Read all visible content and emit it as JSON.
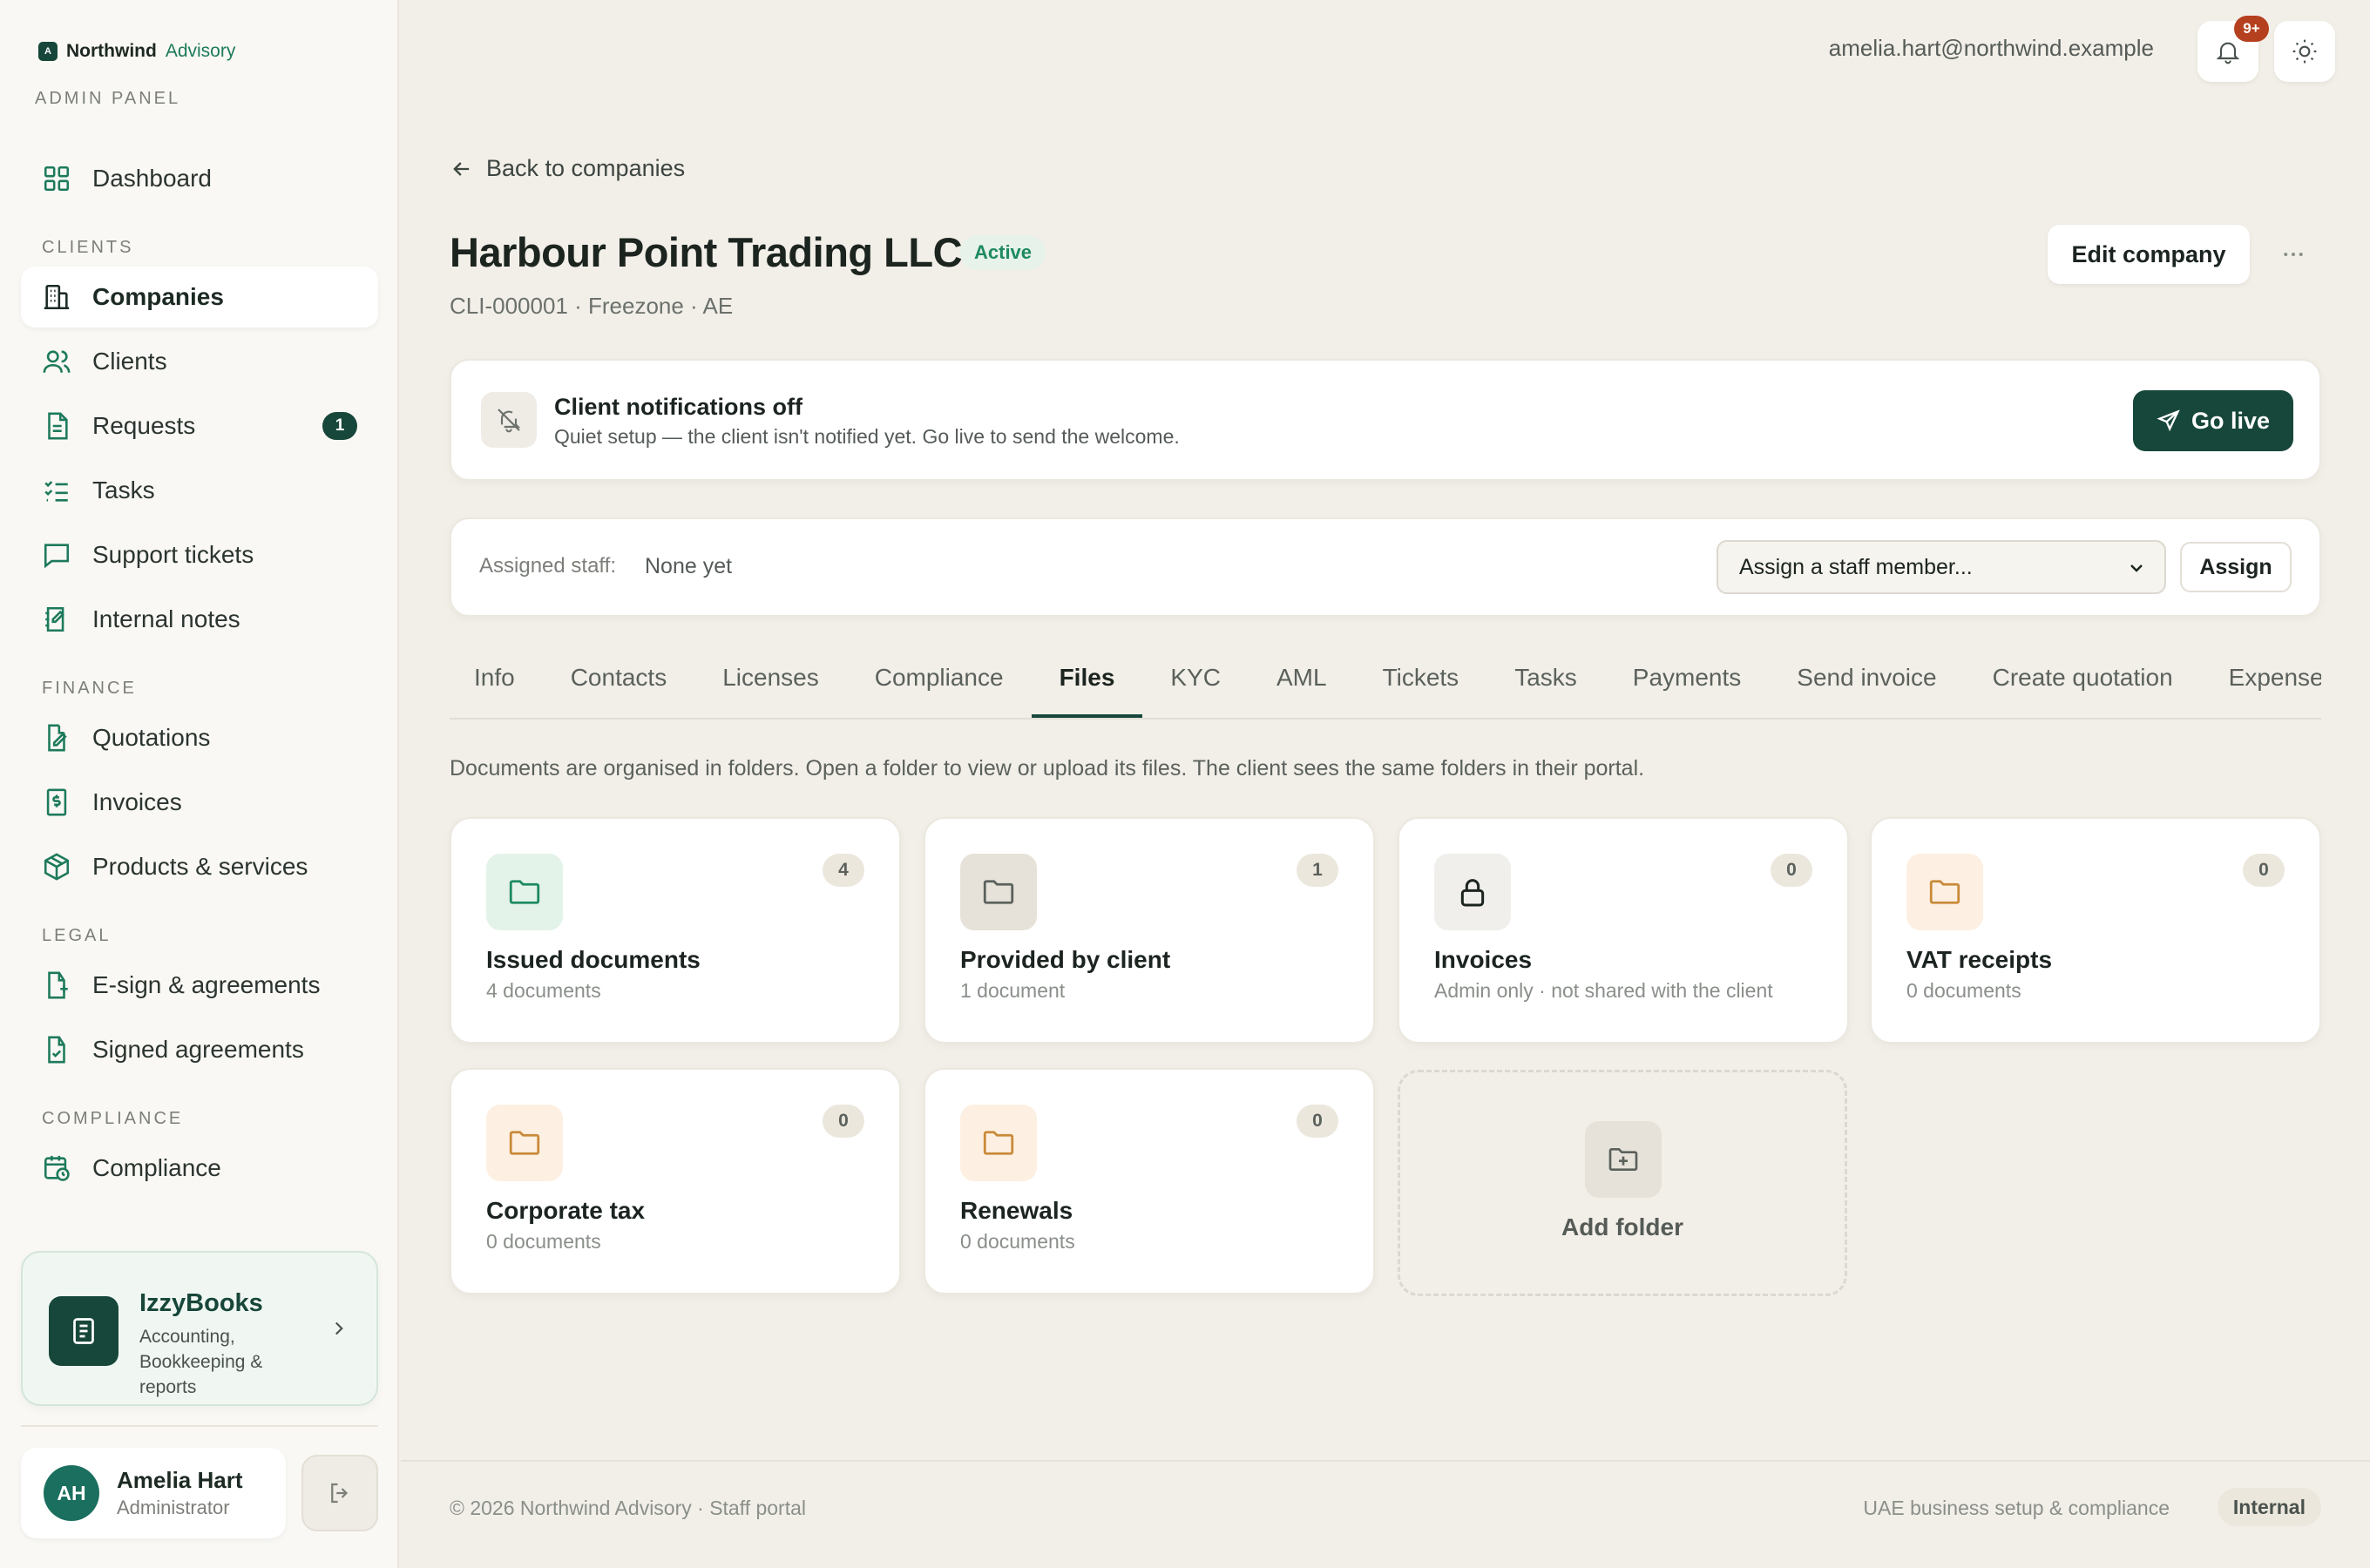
{
  "brand": {
    "name": "Northwind",
    "sub": "Advisory",
    "panel_label": "ADMIN PANEL"
  },
  "sidebar": {
    "dashboard": "Dashboard",
    "sections": {
      "clients": "CLIENTS",
      "finance": "FINANCE",
      "legal": "LEGAL",
      "compliance": "COMPLIANCE"
    },
    "items": {
      "companies": "Companies",
      "clients": "Clients",
      "requests": "Requests",
      "requests_badge": "1",
      "tasks": "Tasks",
      "support_tickets": "Support tickets",
      "internal_notes": "Internal notes",
      "quotations": "Quotations",
      "invoices": "Invoices",
      "products_services": "Products & services",
      "esign": "E-sign & agreements",
      "signed": "Signed agreements",
      "compliance": "Compliance"
    },
    "promo": {
      "title": "IzzyBooks",
      "subtitle": "Accounting, Bookkeeping & reports"
    },
    "user": {
      "initials": "AH",
      "name": "Amelia Hart",
      "role": "Administrator"
    }
  },
  "topbar": {
    "email": "amelia.hart@northwind.example",
    "notif_badge": "9+"
  },
  "company": {
    "back_label": "Back to companies",
    "name": "Harbour Point Trading LLC",
    "status": "Active",
    "meta": "CLI-000001 · Freezone · AE",
    "edit_label": "Edit company"
  },
  "notice": {
    "title": "Client notifications off",
    "subtitle": "Quiet setup — the client isn't notified yet. Go live to send the welcome.",
    "button": "Go live"
  },
  "staff": {
    "label": "Assigned staff:",
    "value": "None yet",
    "select_value": "Assign a staff member...",
    "assign_label": "Assign"
  },
  "tabs": [
    "Info",
    "Contacts",
    "Licenses",
    "Compliance",
    "Files",
    "KYC",
    "AML",
    "Tickets",
    "Tasks",
    "Payments",
    "Send invoice",
    "Create quotation",
    "Expenses"
  ],
  "active_tab": "Files",
  "files": {
    "description": "Documents are organised in folders. Open a folder to view or upload its files. The client sees the same folders in their portal.",
    "folders": [
      {
        "name": "Issued documents",
        "sub": "4 documents",
        "count": "4"
      },
      {
        "name": "Provided by client",
        "sub": "1 document",
        "count": "1"
      },
      {
        "name": "Invoices",
        "sub": "Admin only · not shared with the client",
        "count": "0"
      },
      {
        "name": "VAT receipts",
        "sub": "0 documents",
        "count": "0"
      },
      {
        "name": "Corporate tax",
        "sub": "0 documents",
        "count": "0"
      },
      {
        "name": "Renewals",
        "sub": "0 documents",
        "count": "0"
      }
    ],
    "add_label": "Add folder"
  },
  "footer": {
    "left": "© 2026 Northwind Advisory · Staff portal",
    "right": "UAE business setup & compliance",
    "pill": "Internal"
  },
  "colors": {
    "accent": "#17473a",
    "active_green": "#1d8a60",
    "badge_red": "#b5401f"
  }
}
